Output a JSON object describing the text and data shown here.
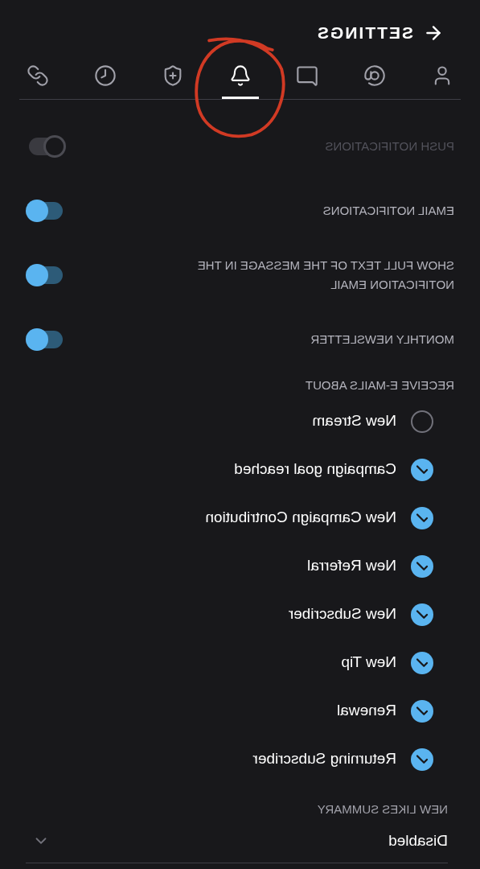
{
  "header": {
    "title": "SETTINGS"
  },
  "tabs": [
    {
      "kind": "user",
      "selected": false
    },
    {
      "kind": "at",
      "selected": false
    },
    {
      "kind": "message",
      "selected": false
    },
    {
      "kind": "bell",
      "selected": true
    },
    {
      "kind": "shield",
      "selected": false
    },
    {
      "kind": "clock",
      "selected": false
    },
    {
      "kind": "link",
      "selected": false
    }
  ],
  "toggles": [
    {
      "label": "PUSH NOTIFICATIONS",
      "on": false,
      "disabled": true
    },
    {
      "label": "EMAIL NOTIFICATIONS",
      "on": true,
      "disabled": false
    },
    {
      "label": "SHOW FULL TEXT OF THE MESSAGE IN THE NOTIFICATION EMAIL",
      "on": true,
      "disabled": false
    },
    {
      "label": "MONTHLY NEWSLETTER",
      "on": true,
      "disabled": false
    }
  ],
  "email_topics": {
    "heading": "RECEIVE E-MAILS ABOUT",
    "items": [
      {
        "label": "New Stream",
        "checked": false
      },
      {
        "label": "Campaign goal reached",
        "checked": true
      },
      {
        "label": "New Campaign Contribution",
        "checked": true
      },
      {
        "label": "New Referral",
        "checked": true
      },
      {
        "label": "New Subscriber",
        "checked": true
      },
      {
        "label": "New Tip",
        "checked": true
      },
      {
        "label": "Renewal",
        "checked": true
      },
      {
        "label": "Returning Subscriber",
        "checked": true
      }
    ]
  },
  "likes_summary": {
    "label": "NEW LIKES SUMMARY",
    "value": "Disabled"
  }
}
